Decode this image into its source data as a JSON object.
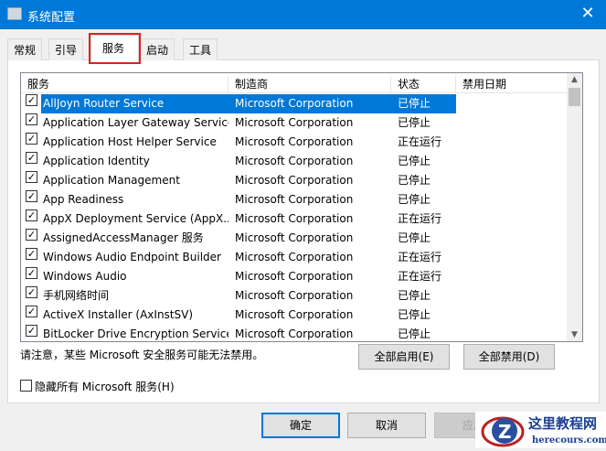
{
  "window": {
    "title": "系统配置",
    "close": "✕"
  },
  "tabs": [
    "常规",
    "引导",
    "服务",
    "启动",
    "工具"
  ],
  "columns": [
    "服务",
    "制造商",
    "状态",
    "禁用日期"
  ],
  "rows": [
    {
      "name": "AllJoyn Router Service",
      "maker": "Microsoft Corporation",
      "status": "已停止",
      "date": ""
    },
    {
      "name": "Application Layer Gateway Service",
      "maker": "Microsoft Corporation",
      "status": "已停止",
      "date": ""
    },
    {
      "name": "Application Host Helper Service",
      "maker": "Microsoft Corporation",
      "status": "正在运行",
      "date": ""
    },
    {
      "name": "Application Identity",
      "maker": "Microsoft Corporation",
      "status": "已停止",
      "date": ""
    },
    {
      "name": "Application Management",
      "maker": "Microsoft Corporation",
      "status": "已停止",
      "date": ""
    },
    {
      "name": "App Readiness",
      "maker": "Microsoft Corporation",
      "status": "已停止",
      "date": ""
    },
    {
      "name": "AppX Deployment Service (AppX...",
      "maker": "Microsoft Corporation",
      "status": "正在运行",
      "date": ""
    },
    {
      "name": "AssignedAccessManager 服务",
      "maker": "Microsoft Corporation",
      "status": "已停止",
      "date": ""
    },
    {
      "name": "Windows Audio Endpoint Builder",
      "maker": "Microsoft Corporation",
      "status": "正在运行",
      "date": ""
    },
    {
      "name": "Windows Audio",
      "maker": "Microsoft Corporation",
      "status": "正在运行",
      "date": ""
    },
    {
      "name": "手机网络时间",
      "maker": "Microsoft Corporation",
      "status": "已停止",
      "date": ""
    },
    {
      "name": "ActiveX Installer (AxInstSV)",
      "maker": "Microsoft Corporation",
      "status": "已停止",
      "date": ""
    },
    {
      "name": "BitLocker Drive Encryption Service",
      "maker": "Microsoft Corporation",
      "status": "已停止",
      "date": ""
    }
  ],
  "note": "请注意，某些 Microsoft 安全服务可能无法禁用。",
  "enable_all": "全部启用(E)",
  "disable_all": "全部禁用(D)",
  "hide_ms": "隐藏所有 Microsoft 服务(H)",
  "ok": "确定",
  "cancel": "取消",
  "apply": "应用",
  "watermark": {
    "title": "这里教程网",
    "url": "herecours.com"
  }
}
